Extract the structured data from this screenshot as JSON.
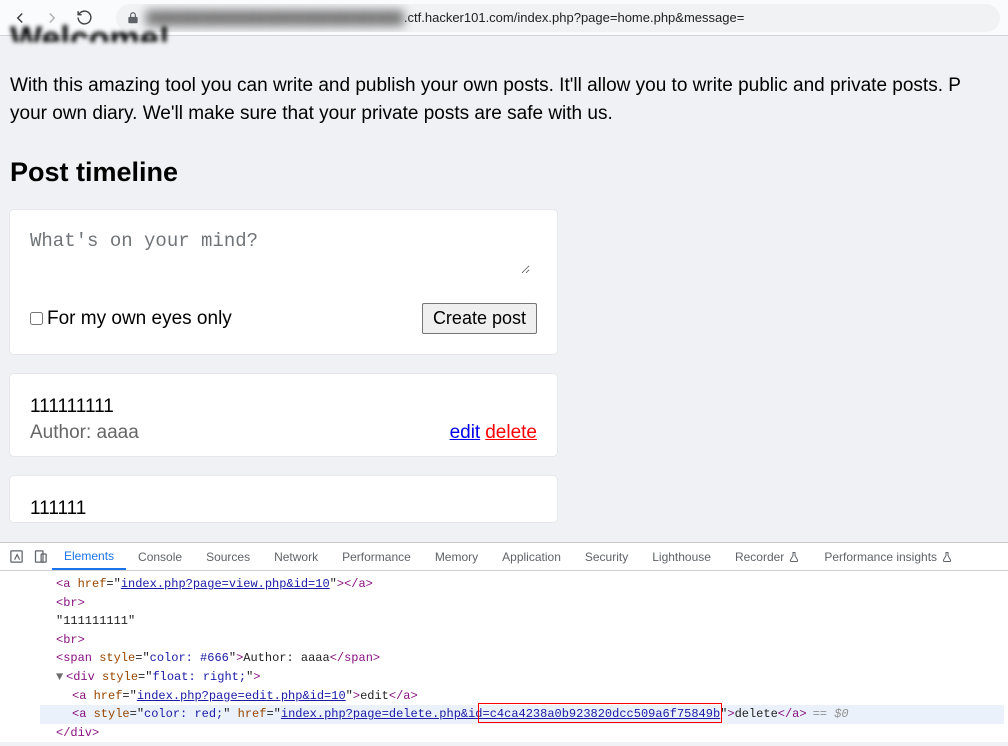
{
  "browser": {
    "url_hidden": "████████████████████████████",
    "url_visible": ".ctf.hacker101.com/index.php?page=home.php&message="
  },
  "page": {
    "welcome_cut": "Welcome!",
    "intro_line1": "With this amazing tool you can write and publish your own posts. It'll allow you to write public and private posts. P",
    "intro_line2": "your own diary. We'll make sure that your private posts are safe with us.",
    "heading": "Post timeline"
  },
  "composer": {
    "placeholder": "What's on your mind?",
    "checkbox_label": "For my own eyes only",
    "button": "Create post"
  },
  "posts": [
    {
      "title": "111111111",
      "author_label": "Author: aaaa",
      "edit": "edit",
      "delete": "delete"
    },
    {
      "title": "111111"
    }
  ],
  "devtools": {
    "tabs": [
      "Elements",
      "Console",
      "Sources",
      "Network",
      "Performance",
      "Memory",
      "Application",
      "Security",
      "Lighthouse",
      "Recorder",
      "Performance insights"
    ],
    "line1_pre": "a",
    "line1_href": "index.php?page=view.php&id=10",
    "br": "br",
    "text1": "\"111111111\"",
    "author_style": "color: #666",
    "author_text": "Author: aaaa",
    "div_style": "float: right;",
    "edit_href": "index.php?page=edit.php&id=10",
    "edit_text": "edit",
    "delete_style": "color: red;",
    "delete_href_pre": "index.php?page=delete.php&id",
    "delete_href_boxed": "=c4ca4238a0b923820dcc509a6f75849b",
    "delete_text": "delete",
    "eq0": "== $0",
    "close_div": "/div"
  }
}
